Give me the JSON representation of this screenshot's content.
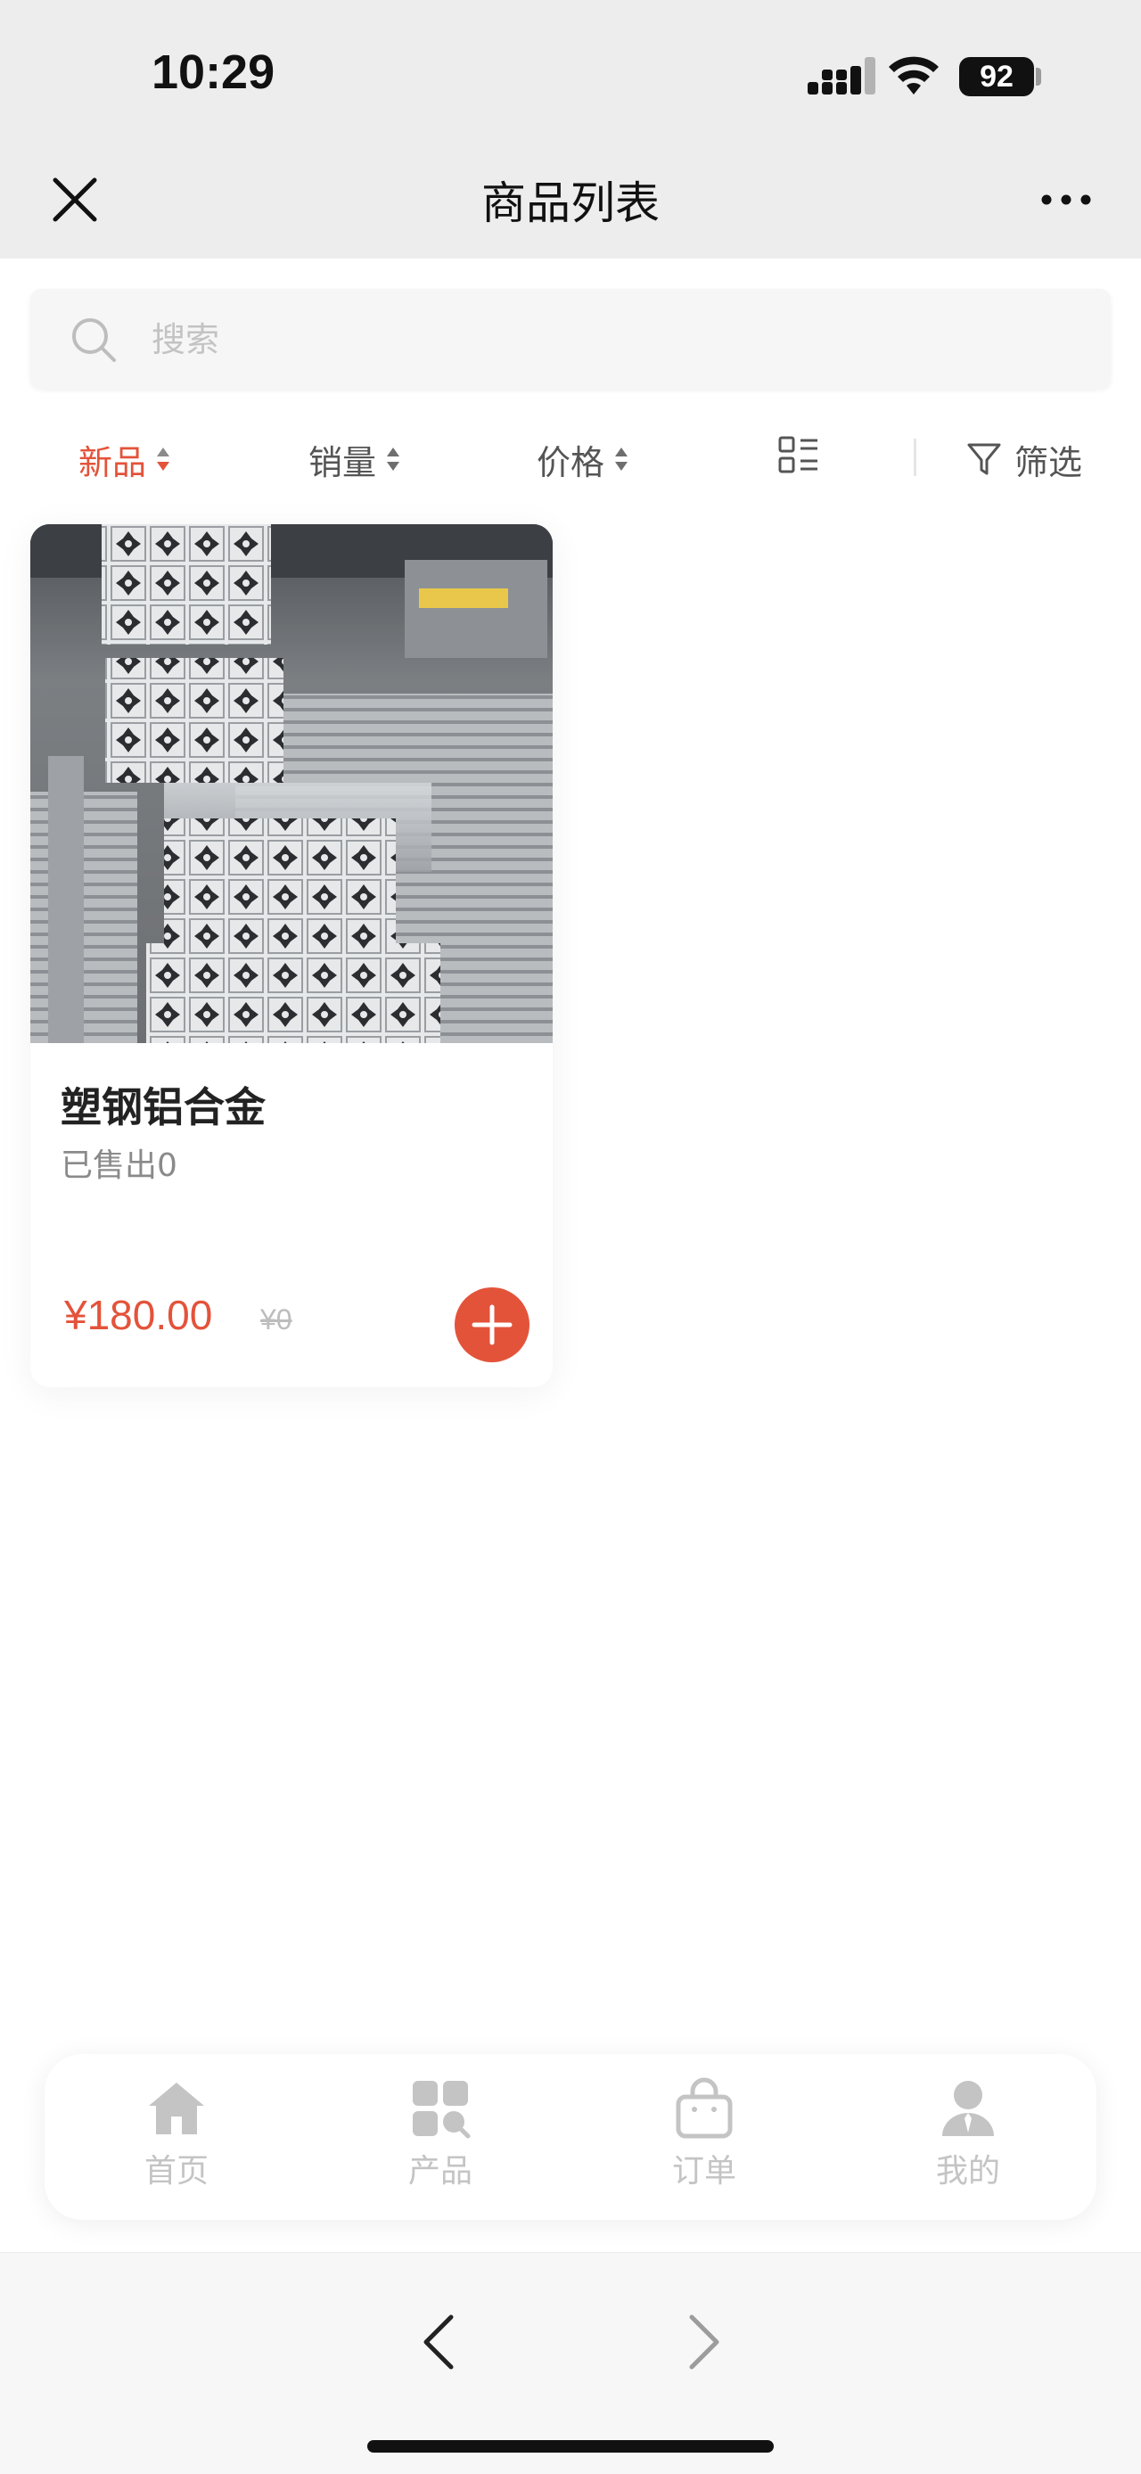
{
  "status_bar": {
    "time": "10:29",
    "battery": "92"
  },
  "header": {
    "title": "商品列表"
  },
  "search": {
    "placeholder": "搜索"
  },
  "sort_bar": {
    "items": [
      {
        "label": "新品",
        "active": true
      },
      {
        "label": "销量",
        "active": false
      },
      {
        "label": "价格",
        "active": false
      }
    ],
    "filter_label": "筛选"
  },
  "products": [
    {
      "name": "塑钢铝合金",
      "sold": "已售出0",
      "price": "¥180.00",
      "original_price": "¥0"
    }
  ],
  "tab_bar": {
    "items": [
      {
        "label": "首页",
        "icon": "home-icon"
      },
      {
        "label": "产品",
        "icon": "grid-icon"
      },
      {
        "label": "订单",
        "icon": "bag-icon"
      },
      {
        "label": "我的",
        "icon": "user-icon"
      }
    ]
  },
  "colors": {
    "accent": "#e3533a",
    "header_bg": "#ededed",
    "tab_inactive": "#c4c4c4"
  }
}
